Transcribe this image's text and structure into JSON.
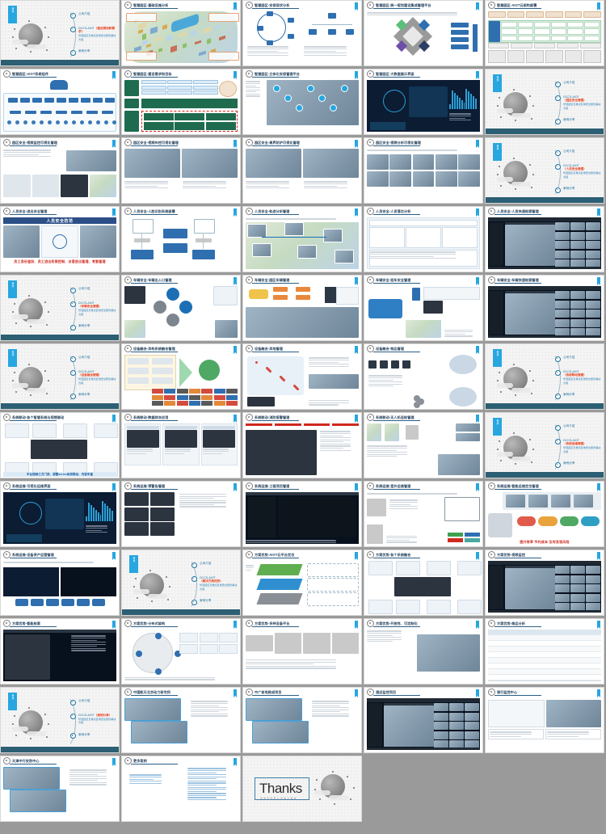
{
  "meta": {
    "background_color": "#9a9a9a",
    "slide_bg": "#ffffff",
    "accent_cyan": "#27a6e0",
    "accent_navy": "#1b3a57",
    "accent_red": "#cf2a1e",
    "columns": 5,
    "rows": 10,
    "total_slides": 48
  },
  "divider": {
    "tab_label": "目录",
    "items": [
      {
        "label": "公司介绍",
        "sub": ""
      },
      {
        "label": "DCCS-AIOT",
        "highlight": "",
        "sub": "智慧园区及重点区域安全照管解决方案"
      },
      {
        "label": "案例分享",
        "sub": ""
      }
    ]
  },
  "slides": [
    {
      "n": 1,
      "kind": "divider",
      "title": "目录",
      "highlight": "建设规划和需求"
    },
    {
      "n": 2,
      "kind": "content",
      "title": "智慧园区-基础设施分析",
      "layout": "isometric-map"
    },
    {
      "n": 3,
      "kind": "content",
      "title": "智慧园区-安保现状分析",
      "layout": "cycle-diagram"
    },
    {
      "n": 4,
      "kind": "content",
      "title": "智慧园区-统一规划建设集成管理平台",
      "layout": "diamond-integration"
    },
    {
      "n": 5,
      "kind": "content",
      "title": "智慧园区-AIOT云架构部署",
      "layout": "stack-table"
    },
    {
      "n": 6,
      "kind": "content",
      "title": "智慧园区-AIOT系统组件",
      "layout": "tree-architecture"
    },
    {
      "n": 7,
      "kind": "content",
      "title": "智慧园区-建设需求和目标",
      "layout": "green-blocks"
    },
    {
      "n": 8,
      "kind": "content",
      "title": "智慧园区-立体化安保管理平台",
      "layout": "building-3d"
    },
    {
      "n": 9,
      "kind": "content",
      "title": "智慧园区-大数据展示界面",
      "layout": "dark-dashboard"
    },
    {
      "n": 10,
      "kind": "divider",
      "title": "目录",
      "highlight": "园区安全管理"
    },
    {
      "n": 11,
      "kind": "content",
      "title": "园区安全-视频监控可视化管理",
      "layout": "video-wall-mobile"
    },
    {
      "n": 12,
      "kind": "content",
      "title": "园区安全-视频布控可视化管理",
      "layout": "two-photo-bullets"
    },
    {
      "n": 13,
      "kind": "content",
      "title": "园区安全-周界防护可视化管理",
      "layout": "two-photo-bullets"
    },
    {
      "n": 14,
      "kind": "content",
      "title": "园区安全-视频分析可视化管理",
      "layout": "thumb-grid"
    },
    {
      "n": 15,
      "kind": "divider",
      "title": "目录",
      "highlight": "人员安全管理"
    },
    {
      "n": 16,
      "kind": "content",
      "title": "人员安全-进出安全管理",
      "banner": "人员安全防范",
      "footer": "员工身份鉴别、员工进出权限控制、访客进出管理、考勤管理",
      "layout": "banner-photos"
    },
    {
      "n": 17,
      "kind": "content",
      "title": "人员安全-人脸识别系统部署",
      "layout": "device-topology"
    },
    {
      "n": 18,
      "kind": "content",
      "title": "人员安全-轨迹分析管理",
      "layout": "map-track"
    },
    {
      "n": 19,
      "kind": "content",
      "title": "人员安全-人员落位分析",
      "layout": "light-dashboard"
    },
    {
      "n": 20,
      "kind": "content",
      "title": "人员安全-人员快速检索管理",
      "layout": "vms-client"
    },
    {
      "n": 21,
      "kind": "divider",
      "title": "目录",
      "highlight": "车辆安全管理"
    },
    {
      "n": 22,
      "kind": "content",
      "title": "车辆安全-车辆出入口管理",
      "layout": "four-circle"
    },
    {
      "n": 23,
      "kind": "content",
      "title": "车辆安全-园区车辆管理",
      "layout": "car-road"
    },
    {
      "n": 24,
      "kind": "content",
      "title": "车辆安全-班车安全管理",
      "layout": "bus-map"
    },
    {
      "n": 25,
      "kind": "content",
      "title": "车辆安全-车辆快速检索管理",
      "layout": "vms-client"
    },
    {
      "n": 26,
      "kind": "divider",
      "title": "目录",
      "highlight": "设备融合管理"
    },
    {
      "n": 27,
      "kind": "content",
      "title": "设备融合-异构系统融合管理",
      "layout": "funnel-logos"
    },
    {
      "n": 28,
      "kind": "content",
      "title": "设备融合-异地管理",
      "layout": "china-map"
    },
    {
      "n": 29,
      "kind": "content",
      "title": "设备融合-物品管理",
      "layout": "rfid-flow"
    },
    {
      "n": 30,
      "kind": "divider",
      "title": "目录",
      "highlight": "系统联动管理"
    },
    {
      "n": 31,
      "kind": "content",
      "title": "系统联动-各个智慧系统与视频联动",
      "footer": "平台视频三方门禁、报警series系统联动、内容丰富",
      "layout": "linkage-hub"
    },
    {
      "n": 32,
      "kind": "content",
      "title": "系统联动-数据综合应用",
      "layout": "three-phone"
    },
    {
      "n": 33,
      "kind": "content",
      "title": "系统联动-消防报警管理",
      "layout": "fire-dark"
    },
    {
      "n": 34,
      "kind": "content",
      "title": "系统联动-无人机巡检管理",
      "layout": "drone-flow"
    },
    {
      "n": 35,
      "kind": "divider",
      "title": "目录",
      "highlight": "系统运维管理"
    },
    {
      "n": 36,
      "kind": "content",
      "title": "系统运维-可视化运维界面",
      "layout": "dark-dashboard"
    },
    {
      "n": 37,
      "kind": "content",
      "title": "系统运维-预警告管理",
      "layout": "screens-notes"
    },
    {
      "n": 38,
      "kind": "content",
      "title": "系统运维-工程项目管理",
      "layout": "cad-drawing"
    },
    {
      "n": 39,
      "kind": "content",
      "title": "系统运维-室外运维管理",
      "layout": "cabinet-monitor"
    },
    {
      "n": 40,
      "kind": "content",
      "title": "系统运维-智能运维定位管理",
      "footer": "提升效率 节约成本 及时发现风险",
      "layout": "persona-pills"
    },
    {
      "n": 41,
      "kind": "content",
      "title": "系统运维-设备资产运营管理",
      "layout": "chart-buttons"
    },
    {
      "n": 42,
      "kind": "divider",
      "title": "目录",
      "highlight": "解决方案优势"
    },
    {
      "n": 43,
      "kind": "content",
      "title": "方案优势-AIOT云平台定位",
      "layout": "layer-ribbon"
    },
    {
      "n": 44,
      "kind": "content",
      "title": "方案优势-各个系统融合",
      "layout": "linkage-hub"
    },
    {
      "n": 45,
      "kind": "content",
      "title": "方案优势-视频监控",
      "layout": "vms-client"
    },
    {
      "n": 46,
      "kind": "content",
      "title": "方案优势-智能检索",
      "layout": "dark-search"
    },
    {
      "n": 47,
      "kind": "content",
      "title": "方案优势-分布式架构",
      "layout": "ring-devices"
    },
    {
      "n": 48,
      "kind": "content",
      "title": "方案优势-多种设备平台",
      "layout": "device-lineup"
    },
    {
      "n": 49,
      "kind": "content",
      "title": "方案优势-开放性、可定制化",
      "layout": "handshake"
    },
    {
      "n": 50,
      "kind": "content",
      "title": "方案优势-商品分析",
      "layout": "spec-table"
    },
    {
      "n": 51,
      "kind": "divider",
      "title": "目录",
      "highlight": "案例分享"
    },
    {
      "n": 52,
      "kind": "content",
      "title": "中国航天北京动力研究所",
      "layout": "photo-bullets"
    },
    {
      "n": 53,
      "kind": "content",
      "title": "中广核电致成项目",
      "layout": "photo-bullets"
    },
    {
      "n": 54,
      "kind": "content",
      "title": "酒店监控项目",
      "layout": "vms-client"
    },
    {
      "n": 55,
      "kind": "content",
      "title": "银行监控中心",
      "layout": "diagram-photo"
    },
    {
      "n": 56,
      "kind": "content",
      "title": "天津中行安防中心",
      "layout": "photo-bullets"
    },
    {
      "n": 57,
      "kind": "content",
      "title": "更多案例",
      "layout": "case-list"
    },
    {
      "n": 58,
      "kind": "thanks",
      "title": "Thanks",
      "subtitle": "感谢您的耐心观看与聆听"
    }
  ],
  "order": [
    0,
    1,
    2,
    3,
    4,
    5,
    6,
    7,
    8,
    9,
    10,
    11,
    12,
    13,
    14,
    15,
    16,
    17,
    18,
    19,
    20,
    21,
    22,
    23,
    24,
    25,
    26,
    27,
    28,
    29,
    30,
    31,
    32,
    33,
    34,
    35,
    36,
    37,
    38,
    39,
    40,
    41,
    42,
    43,
    44,
    45,
    46,
    47,
    48,
    49,
    50,
    51,
    52,
    53,
    54,
    55,
    56,
    57
  ]
}
